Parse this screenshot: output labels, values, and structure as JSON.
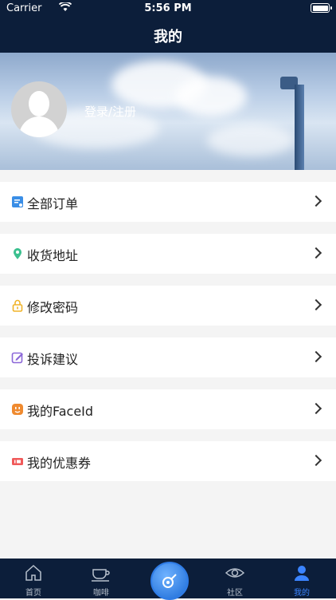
{
  "status_bar": {
    "carrier": "Carrier",
    "time": "5:56 PM"
  },
  "header": {
    "title": "我的"
  },
  "profile": {
    "login_text": "登录/注册"
  },
  "menu": [
    {
      "label": "全部订单",
      "icon": "order-list-icon",
      "color": "#3a8ee6"
    },
    {
      "label": "收货地址",
      "icon": "location-pin-icon",
      "color": "#3cc08f"
    },
    {
      "label": "修改密码",
      "icon": "lock-icon",
      "color": "#f0b429"
    },
    {
      "label": "投诉建议",
      "icon": "edit-icon",
      "color": "#8b67d8"
    },
    {
      "label": "我的FaceId",
      "icon": "face-id-icon",
      "color": "#ef8a2f"
    },
    {
      "label": "我的优惠券",
      "icon": "coupon-icon",
      "color": "#f05a5a"
    }
  ],
  "tabbar": {
    "items": [
      {
        "label": "首页",
        "icon": "home-icon"
      },
      {
        "label": "咖啡",
        "icon": "coffee-cup-icon"
      },
      {
        "label": "",
        "icon": "center-action-icon"
      },
      {
        "label": "社区",
        "icon": "eye-icon"
      },
      {
        "label": "我的",
        "icon": "user-icon"
      }
    ],
    "active_color": "#3b84ff"
  }
}
